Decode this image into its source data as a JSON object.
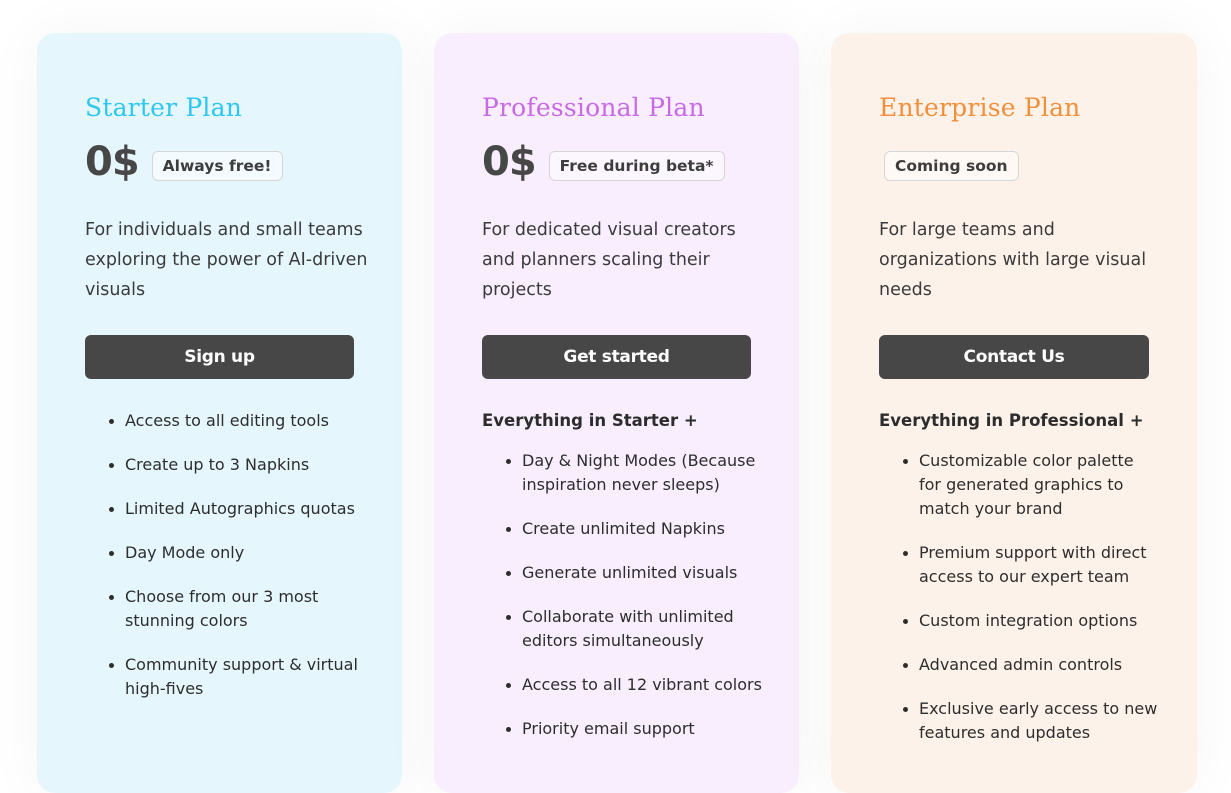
{
  "plans": {
    "starter": {
      "title": "Starter Plan",
      "price": "0$",
      "badge": "Always free!",
      "description": "For individuals and small teams exploring the power of AI-driven visuals",
      "cta": "Sign up",
      "features": [
        "Access to all editing tools",
        "Create up to 3 Napkins",
        "Limited Autographics quotas",
        "Day Mode only",
        "Choose from our 3 most stunning colors",
        "Community support & virtual high-fives"
      ]
    },
    "professional": {
      "title": "Professional Plan",
      "price": "0$",
      "badge": "Free during beta*",
      "description": "For dedicated visual creators and planners scaling their projects",
      "cta": "Get started",
      "lead": "Everything in Starter +",
      "features": [
        "Day & Night Modes (Because inspiration never sleeps)",
        "Create unlimited Napkins",
        "Generate unlimited visuals",
        "Collaborate with unlimited editors simultaneously",
        "Access to all 12 vibrant colors",
        "Priority email support"
      ]
    },
    "enterprise": {
      "title": "Enterprise Plan",
      "badge": "Coming soon",
      "description": "For large teams and organizations with large visual needs",
      "cta": "Contact Us",
      "lead": "Everything in Professional +",
      "features": [
        "Customizable color palette for generated graphics to match your brand",
        "Premium support with direct access to our expert team",
        "Custom integration options",
        "Advanced admin controls",
        "Exclusive early access to new features and updates"
      ]
    }
  },
  "colors": {
    "starter_accent": "#2ec7f0",
    "professional_accent": "#c86ae8",
    "enterprise_accent": "#f28f3b",
    "button_bg": "#474747"
  }
}
